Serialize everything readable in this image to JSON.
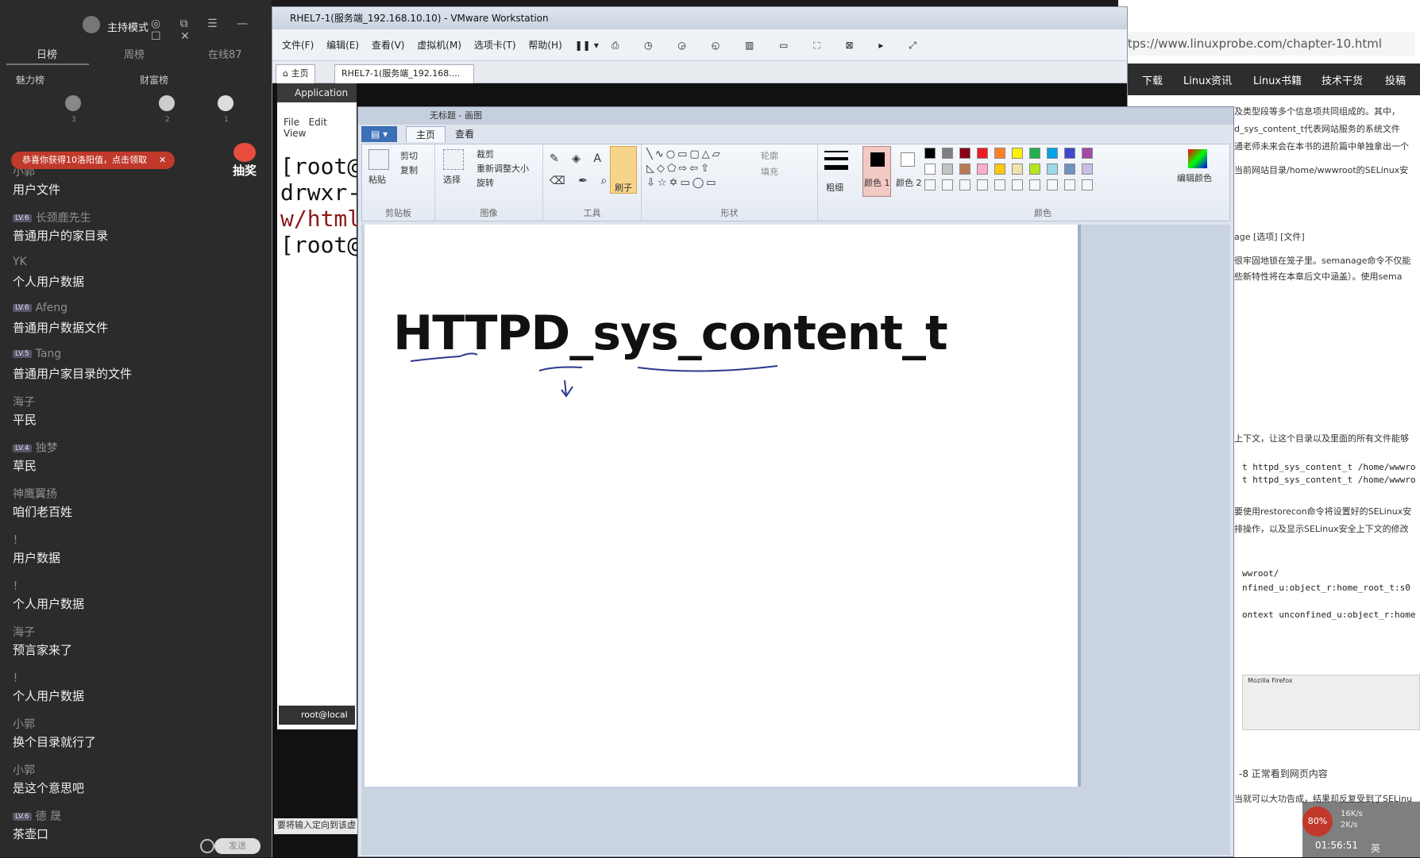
{
  "chat": {
    "mode": "主持模式",
    "tabs": [
      "日榜",
      "周榜",
      "在线87"
    ],
    "rank_left": "魅力榜",
    "rank_right": "财富榜",
    "ranks": [
      "3",
      "2",
      "1"
    ],
    "banner": "恭喜你获得10洛阳值，点击领取",
    "lottery": "抽奖",
    "input_placeholder": "发送",
    "messages": [
      {
        "user": "小郭",
        "level": "",
        "text": "用户文件"
      },
      {
        "user": "长颈鹿先生",
        "level": "LV.6",
        "text": "普通用户的家目录"
      },
      {
        "user": "YK",
        "level": "",
        "text": "个人用户数据"
      },
      {
        "user": "Afeng",
        "level": "LV.6",
        "text": "普通用户数据文件"
      },
      {
        "user": "Tang",
        "level": "LV.5",
        "text": "普通用户家目录的文件"
      },
      {
        "user": "海子",
        "level": "",
        "text": "平民"
      },
      {
        "user": "独梦",
        "level": "LV.4",
        "text": "草民"
      },
      {
        "user": "神鹰翼扬",
        "level": "",
        "text": "咱们老百姓"
      },
      {
        "user": "！",
        "level": "",
        "text": "用户数据"
      },
      {
        "user": "！",
        "level": "",
        "text": "个人用户数据"
      },
      {
        "user": "海子",
        "level": "",
        "text": "预言家来了"
      },
      {
        "user": "！",
        "level": "",
        "text": "个人用户数据"
      },
      {
        "user": "小郭",
        "level": "",
        "text": "换个目录就行了"
      },
      {
        "user": "小郭",
        "level": "",
        "text": "是这个意思吧"
      },
      {
        "user": "德 晟",
        "level": "LV.6",
        "text": "茶壶口"
      }
    ]
  },
  "vmware": {
    "title": "RHEL7-1(服务端_192.168.10.10) - VMware Workstation",
    "menu": [
      "文件(F)",
      "编辑(E)",
      "查看(V)",
      "虚拟机(M)",
      "选项卡(T)",
      "帮助(H)"
    ],
    "tab_home": "主页",
    "tab_vm": "RHEL7-1(服务端_192.168....",
    "app_label": "Application",
    "term_menu": [
      "File",
      "Edit",
      "View"
    ],
    "term_lines": [
      "[root@",
      "drwxr-",
      "w/html",
      "[root@"
    ],
    "task_label": "root@local",
    "status_text": "要将输入定向到该虚"
  },
  "paint": {
    "title": "无标题 - 画图",
    "tabs": [
      "主页",
      "查看"
    ],
    "groups": [
      "剪贴板",
      "图像",
      "工具",
      "形状",
      "颜色"
    ],
    "clipboard": {
      "paste": "粘贴",
      "cut": "剪切",
      "copy": "复制"
    },
    "image": {
      "select": "选择",
      "crop": "裁剪",
      "resize": "重新调整大小",
      "rotate": "旋转"
    },
    "brush": "刷子",
    "outline": "轮廓",
    "fill": "填充",
    "size": "粗细",
    "color1": "颜色 1",
    "color2": "颜色 2",
    "edit_colors": "编辑颜色",
    "canvas_text": "HTTPD_sys_content_t",
    "swatches": [
      "#000000",
      "#7f7f7f",
      "#880015",
      "#ed1c24",
      "#ff7f27",
      "#fff200",
      "#22b14c",
      "#00a2e8",
      "#3f48cc",
      "#a349a4",
      "#ffffff",
      "#c3c3c3",
      "#b97a57",
      "#ffaec9",
      "#ffc90e",
      "#efe4b0",
      "#b5e61d",
      "#99d9ea",
      "#7092be",
      "#c8bfe7"
    ]
  },
  "browser": {
    "url": "ttps://www.linuxprobe.com/chapter-10.html",
    "nav": [
      "下载",
      "Linux资讯",
      "Linux书籍",
      "技术干货",
      "投稿"
    ],
    "snippets": [
      "及类型段等多个信息项共同组成的。其中，",
      "d_sys_content_t代表网站服务的系统文件",
      "通老师未来会在本书的进阶篇中单独拿出一个",
      "当前网站目录/home/wwwroot的SELinux安",
      "age [选项] [文件]",
      "很牢固地锁在笼子里。semanage命令不仅能",
      "些新特性将在本章后文中涵盖）。使用sema",
      "上下文，让这个目录以及里面的所有文件能够",
      "要使用restorecon命令将设置好的SELinux安",
      "排操作，以及显示SELinux安全上下文的修改",
      "-8  正常看到网页内容",
      "当就可以大功告成，结果却反复受到了SELinu"
    ],
    "code": [
      "t httpd_sys_content_t /home/wwwro",
      "t httpd_sys_content_t /home/wwwro",
      "wwroot/",
      "nfined_u:object_r:home_root_t:s0",
      "ontext unconfined_u:object_r:home"
    ],
    "subwin_title": "Mozilla Firefox"
  },
  "tray": {
    "cpu": "80%",
    "up": "16K/s",
    "down": "2K/s",
    "clock": "01:56:51",
    "ime": "英"
  }
}
